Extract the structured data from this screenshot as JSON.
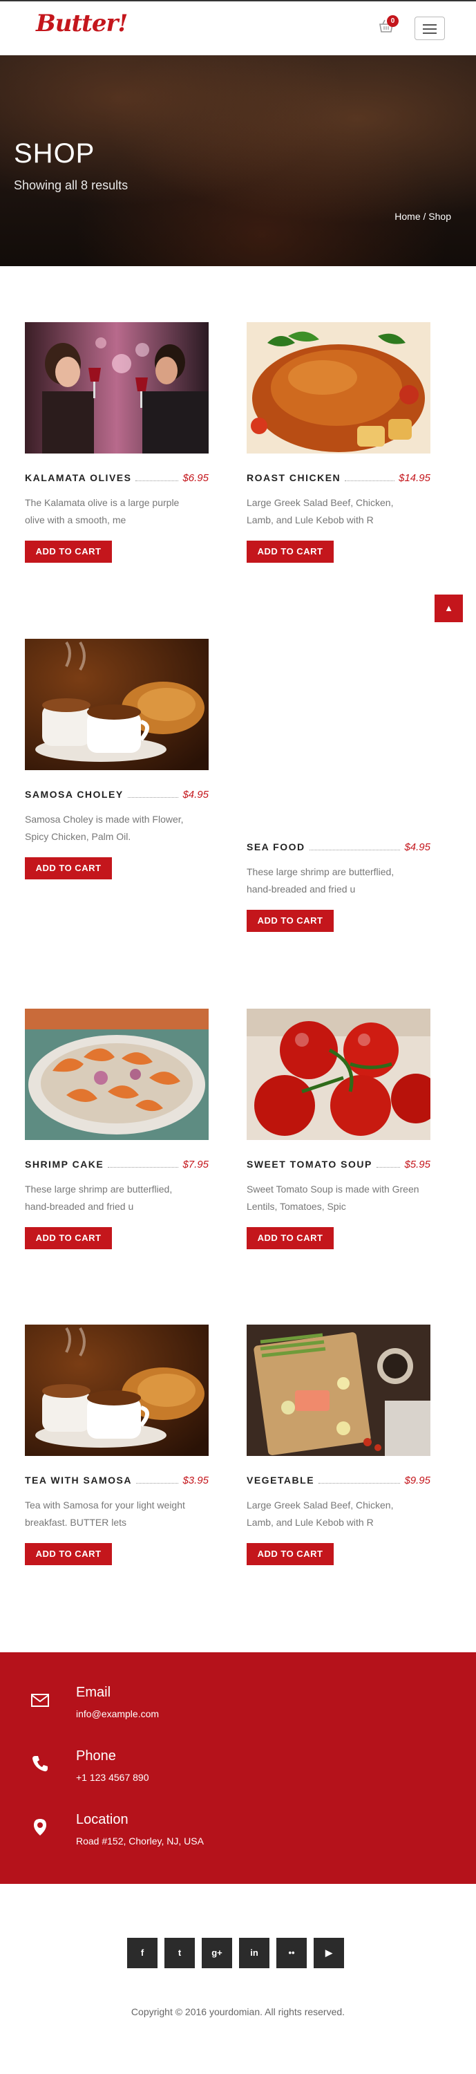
{
  "header": {
    "logo_text": "Butter!",
    "cart_count": "0",
    "brand_color": "#c4161c"
  },
  "hero": {
    "title": "SHOP",
    "subtitle": "Showing all 8 results",
    "breadcrumb": {
      "home": "Home",
      "separator": " / ",
      "current": "Shop"
    }
  },
  "products": [
    {
      "name": "KALAMATA OLIVES",
      "price": "$6.95",
      "description": "The Kalamata olive is a large purple olive with a smooth, me",
      "button": "ADD TO CART",
      "image": "couple-wine-photo"
    },
    {
      "name": "ROAST CHICKEN",
      "price": "$14.95",
      "description": "Large Greek Salad Beef, Chicken, Lamb, and Lule Kebob with R",
      "button": "ADD TO CART",
      "image": "roast-chicken-photo"
    },
    {
      "name": "SAMOSA CHOLEY",
      "price": "$4.95",
      "description": "Samosa Choley is made with Flower, Spicy Chicken, Palm Oil.",
      "button": "ADD TO CART",
      "image": "coffee-croissant-photo"
    },
    {
      "name": "SEA FOOD",
      "price": "$4.95",
      "description": "These large shrimp are butterflied, hand-breaded and fried u",
      "button": "ADD TO CART",
      "image": ""
    },
    {
      "name": "SHRIMP CAKE",
      "price": "$7.95",
      "description": "These large shrimp are butterflied, hand-breaded and fried u",
      "button": "ADD TO CART",
      "image": "shrimp-plate-photo"
    },
    {
      "name": "SWEET TOMATO SOUP",
      "price": "$5.95",
      "description": "Sweet Tomato Soup is made with Green Lentils, Tomatoes, Spic",
      "button": "ADD TO CART",
      "image": "tomatoes-photo"
    },
    {
      "name": "TEA WITH SAMOSA",
      "price": "$3.95",
      "description": "Tea with Samosa for your light weight breakfast. BUTTER lets",
      "button": "ADD TO CART",
      "image": "coffee-croissant-photo"
    },
    {
      "name": "VEGETABLE",
      "price": "$9.95",
      "description": "Large Greek Salad Beef, Chicken, Lamb, and Lule Kebob with R",
      "button": "ADD TO CART",
      "image": "vegetable-board-photo"
    }
  ],
  "contact": [
    {
      "title": "Email",
      "value": "info@example.com",
      "icon": "envelope-icon"
    },
    {
      "title": "Phone",
      "value": "+1 123 4567 890",
      "icon": "phone-icon"
    },
    {
      "title": "Location",
      "value": "Road #152, Chorley, NJ, USA",
      "icon": "map-marker-icon"
    }
  ],
  "footer": {
    "socials": [
      {
        "name": "facebook",
        "glyph": "f"
      },
      {
        "name": "twitter",
        "glyph": "t"
      },
      {
        "name": "google-plus",
        "glyph": "g+"
      },
      {
        "name": "linkedin",
        "glyph": "in"
      },
      {
        "name": "flickr",
        "glyph": "••"
      },
      {
        "name": "youtube",
        "glyph": "▶"
      }
    ],
    "copyright": "Copyright © 2016 yourdomian. All rights reserved."
  }
}
